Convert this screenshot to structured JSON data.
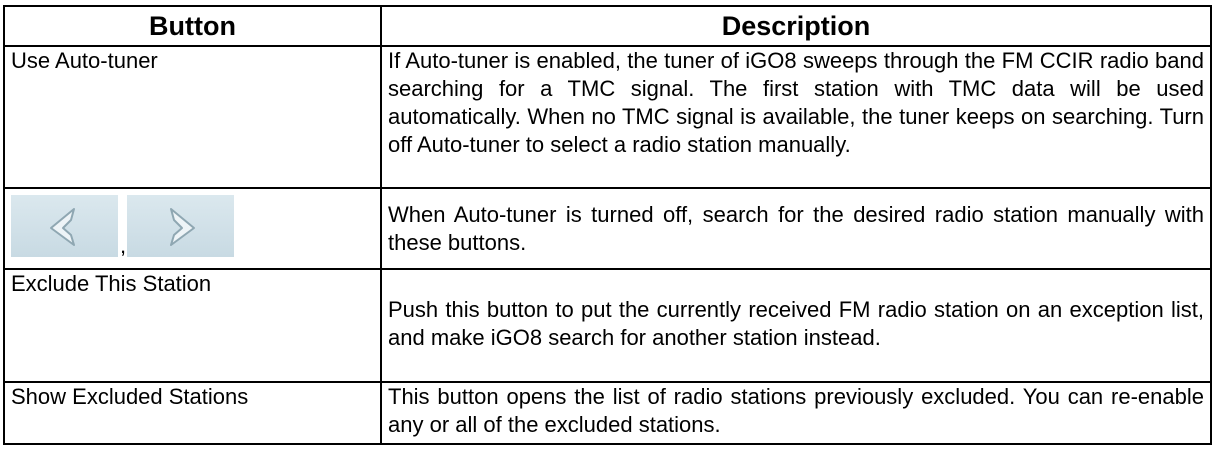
{
  "table": {
    "header": {
      "button": "Button",
      "description": "Description"
    },
    "rows": [
      {
        "button": "Use Auto-tuner",
        "description": "If Auto-tuner is enabled, the tuner of iGO8 sweeps through the FM CCIR radio band searching for a TMC signal. The first station with TMC data will be used automatically. When no TMC signal is available, the tuner keeps on searching. Turn off Auto-tuner to select a radio station manually."
      },
      {
        "button_icons": [
          "left-arrow-icon",
          "right-arrow-icon"
        ],
        "separator": ",",
        "description": "When Auto-tuner is turned off, search for the desired radio station manually with these buttons."
      },
      {
        "button": "Exclude This Station",
        "description": "Push this button to put the currently received FM radio station on an exception list, and make iGO8 search for another station instead."
      },
      {
        "button": "Show Excluded Stations",
        "description": "This button opens the list of radio stations previously excluded. You can re-enable any or all of the excluded stations."
      }
    ]
  },
  "colors": {
    "arrow_button_bg": "#d2e2e9",
    "arrow_stroke": "#8fa7b2",
    "arrow_fill": "#eef4f7"
  }
}
